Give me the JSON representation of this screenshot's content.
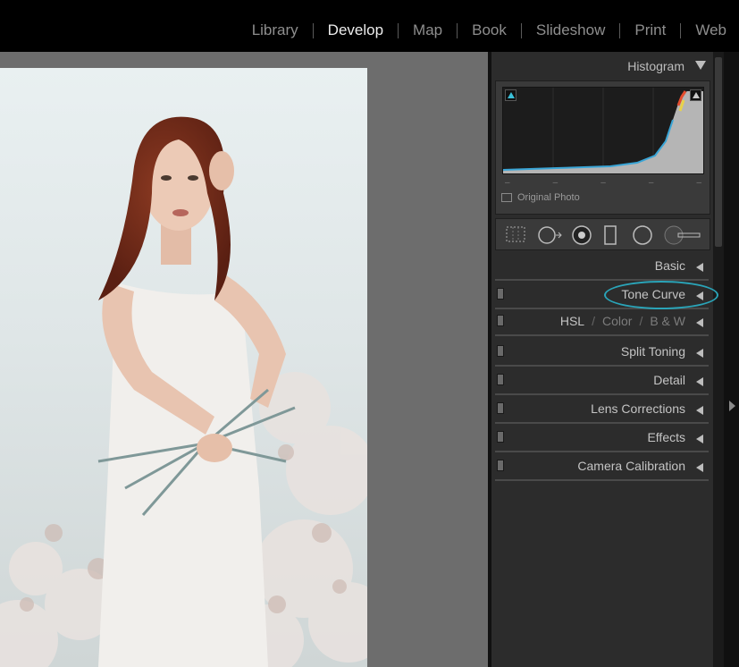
{
  "modules": {
    "items": [
      {
        "label": "Library",
        "active": false
      },
      {
        "label": "Develop",
        "active": true
      },
      {
        "label": "Map",
        "active": false
      },
      {
        "label": "Book",
        "active": false
      },
      {
        "label": "Slideshow",
        "active": false
      },
      {
        "label": "Print",
        "active": false
      },
      {
        "label": "Web",
        "active": false
      }
    ]
  },
  "histogram": {
    "title": "Histogram",
    "original_photo_label": "Original Photo",
    "dashes": [
      "–",
      "–",
      "–",
      "–",
      "–"
    ]
  },
  "panels": {
    "basic": "Basic",
    "tone_curve": "Tone Curve",
    "hsl": "HSL",
    "color": "Color",
    "bw": "B & W",
    "split_toning": "Split Toning",
    "detail": "Detail",
    "lens_corrections": "Lens Corrections",
    "effects": "Effects",
    "camera_calibration": "Camera Calibration"
  },
  "colors": {
    "highlight_ring": "#2aa4b8",
    "shadow_clip": "#3bc0d8"
  }
}
